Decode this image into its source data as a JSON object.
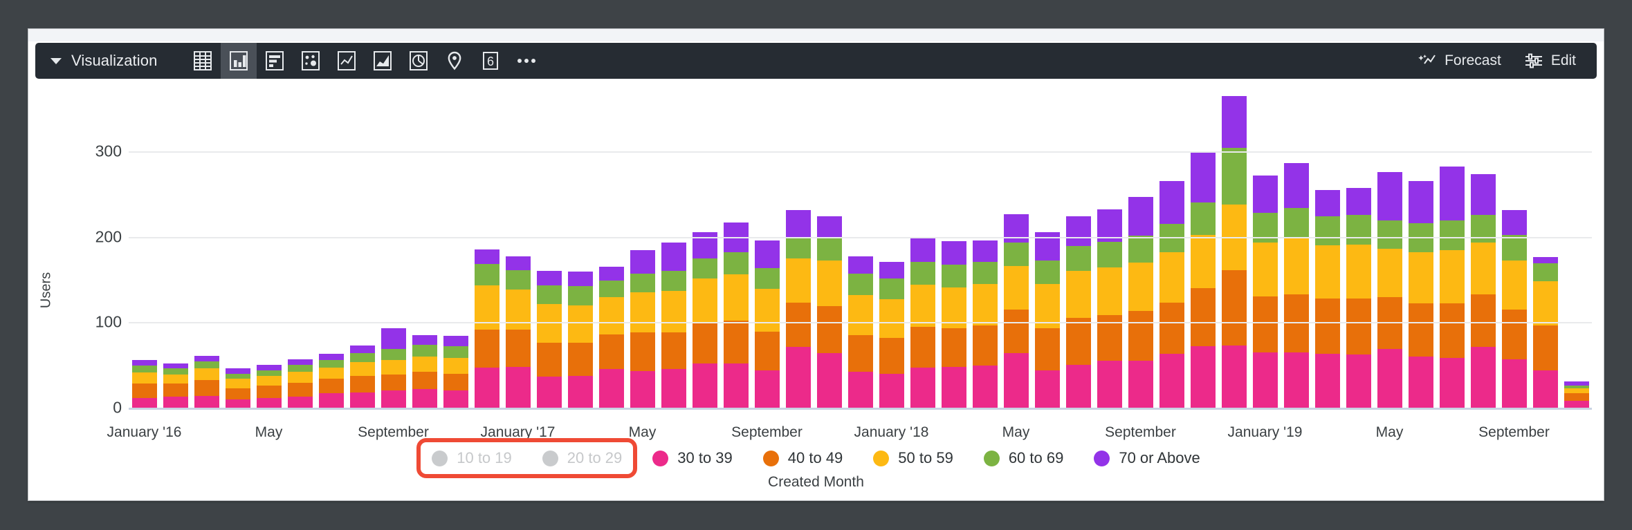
{
  "toolbar": {
    "dropdown_label": "Visualization",
    "caret_icon": "chevron-down-icon",
    "chart_type_buttons": [
      {
        "name": "table-chart-icon",
        "label": "Table",
        "selected": false
      },
      {
        "name": "bar-chart-icon",
        "label": "Column",
        "selected": true
      },
      {
        "name": "horizontal-bar-icon",
        "label": "Bar",
        "selected": false
      },
      {
        "name": "scatter-chart-icon",
        "label": "Scatter",
        "selected": false
      },
      {
        "name": "line-chart-icon",
        "label": "Line",
        "selected": false
      },
      {
        "name": "area-chart-icon",
        "label": "Area",
        "selected": false
      },
      {
        "name": "pie-chart-icon",
        "label": "Pie",
        "selected": false
      },
      {
        "name": "map-pin-icon",
        "label": "Map",
        "selected": false
      },
      {
        "name": "single-value-icon",
        "label": "6",
        "selected": false
      },
      {
        "name": "more-options-icon",
        "label": "More",
        "selected": false
      }
    ],
    "forecast_label": "Forecast",
    "forecast_icon": "sparkle-wand-icon",
    "edit_label": "Edit",
    "edit_icon": "sliders-icon"
  },
  "annotation": {
    "color": "#ef4a35",
    "target": "disabled-legend-items"
  },
  "chart_data": {
    "type": "bar",
    "stacked": true,
    "title": "",
    "xlabel": "Created Month",
    "ylabel": "Users",
    "ylim": [
      0,
      380
    ],
    "yticks": [
      0,
      100,
      200,
      300
    ],
    "grid": true,
    "legend_position": "bottom",
    "xtick_labels": [
      "January '16",
      "May",
      "September",
      "January '17",
      "May",
      "September",
      "January '18",
      "May",
      "September",
      "January '19",
      "May",
      "September"
    ],
    "xtick_indices": [
      0,
      4,
      8,
      12,
      16,
      20,
      24,
      28,
      32,
      36,
      40,
      44
    ],
    "categories": [
      "January '16",
      "February '16",
      "March '16",
      "April '16",
      "May '16",
      "June '16",
      "July '16",
      "August '16",
      "September '16",
      "October '16",
      "November '16",
      "December '16",
      "January '17",
      "February '17",
      "March '17",
      "April '17",
      "May '17",
      "June '17",
      "July '17",
      "August '17",
      "September '17",
      "October '17",
      "November '17",
      "December '17",
      "January '18",
      "February '18",
      "March '18",
      "April '18",
      "May '18",
      "June '18",
      "July '18",
      "August '18",
      "September '18",
      "October '18",
      "November '18",
      "December '18",
      "January '19",
      "February '19",
      "March '19",
      "April '19",
      "May '19",
      "June '19",
      "July '19",
      "August '19",
      "September '19",
      "October '19",
      "November '19"
    ],
    "series": [
      {
        "name": "10 to 19",
        "color": "#c9cbcd",
        "disabled": true,
        "values": [
          0,
          0,
          0,
          0,
          0,
          0,
          0,
          0,
          0,
          0,
          0,
          0,
          0,
          0,
          0,
          0,
          0,
          0,
          0,
          0,
          0,
          0,
          0,
          0,
          0,
          0,
          0,
          0,
          0,
          0,
          0,
          0,
          0,
          0,
          0,
          0,
          0,
          0,
          0,
          0,
          0,
          0,
          0,
          0,
          0,
          0,
          0
        ]
      },
      {
        "name": "20 to 29",
        "color": "#c9cbcd",
        "disabled": true,
        "values": [
          0,
          0,
          0,
          0,
          0,
          0,
          0,
          0,
          0,
          0,
          0,
          0,
          0,
          0,
          0,
          0,
          0,
          0,
          0,
          0,
          0,
          0,
          0,
          0,
          0,
          0,
          0,
          0,
          0,
          0,
          0,
          0,
          0,
          0,
          0,
          0,
          0,
          0,
          0,
          0,
          0,
          0,
          0,
          0,
          0,
          0,
          0
        ]
      },
      {
        "name": "30 to 39",
        "color": "#ec2a8a",
        "disabled": false,
        "values": [
          11,
          13,
          14,
          10,
          11,
          13,
          17,
          18,
          20,
          22,
          20,
          47,
          48,
          36,
          37,
          45,
          43,
          45,
          52,
          52,
          44,
          71,
          64,
          42,
          40,
          47,
          48,
          49,
          64,
          44,
          50,
          55,
          55,
          63,
          72,
          73,
          65,
          65,
          63,
          62,
          69,
          60,
          58,
          71,
          57,
          44,
          8
        ]
      },
      {
        "name": "40 to 49",
        "color": "#e8700a",
        "disabled": false,
        "values": [
          17,
          15,
          18,
          13,
          15,
          16,
          17,
          19,
          19,
          20,
          20,
          44,
          43,
          40,
          39,
          41,
          45,
          43,
          47,
          50,
          45,
          52,
          55,
          43,
          42,
          48,
          45,
          47,
          51,
          49,
          55,
          53,
          58,
          60,
          68,
          88,
          65,
          68,
          65,
          66,
          60,
          62,
          64,
          62,
          58,
          52,
          9
        ]
      },
      {
        "name": "50 to 59",
        "color": "#fdb913",
        "disabled": false,
        "values": [
          13,
          11,
          14,
          11,
          11,
          13,
          13,
          16,
          17,
          18,
          18,
          52,
          47,
          45,
          44,
          43,
          47,
          49,
          52,
          54,
          50,
          52,
          53,
          47,
          45,
          49,
          48,
          49,
          51,
          52,
          55,
          56,
          57,
          59,
          62,
          77,
          63,
          65,
          62,
          63,
          57,
          60,
          62,
          60,
          57,
          52,
          6
        ]
      },
      {
        "name": "60 to 69",
        "color": "#7cb342",
        "disabled": false,
        "values": [
          8,
          7,
          8,
          6,
          7,
          8,
          9,
          11,
          13,
          14,
          14,
          25,
          23,
          22,
          22,
          20,
          22,
          23,
          24,
          26,
          24,
          25,
          28,
          25,
          24,
          27,
          26,
          26,
          27,
          27,
          29,
          30,
          31,
          33,
          38,
          66,
          35,
          36,
          34,
          35,
          33,
          34,
          35,
          33,
          30,
          21,
          3
        ]
      },
      {
        "name": "70 or Above",
        "color": "#9333e8",
        "disabled": false,
        "values": [
          7,
          6,
          7,
          6,
          6,
          7,
          7,
          9,
          24,
          11,
          12,
          17,
          16,
          17,
          17,
          16,
          27,
          33,
          30,
          35,
          33,
          31,
          24,
          20,
          20,
          28,
          28,
          25,
          33,
          33,
          35,
          38,
          46,
          50,
          58,
          61,
          44,
          52,
          31,
          31,
          57,
          49,
          63,
          47,
          29,
          7,
          5
        ]
      }
    ]
  }
}
